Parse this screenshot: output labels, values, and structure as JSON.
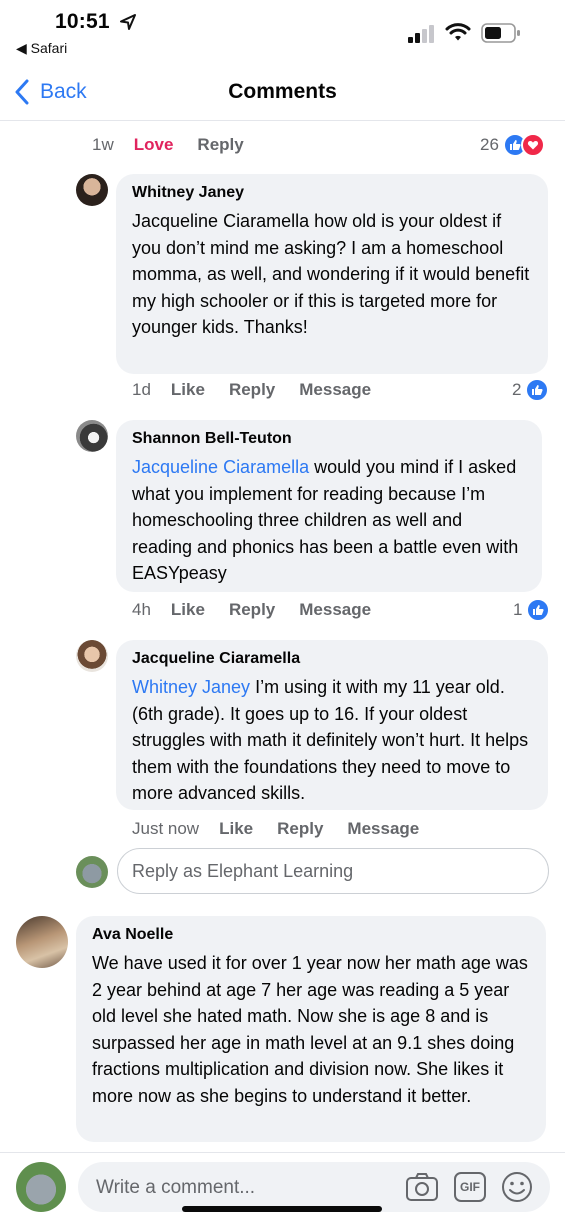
{
  "status_bar": {
    "time": "10:51",
    "back_app": "◀ Safari"
  },
  "nav": {
    "back_label": "Back",
    "title": "Comments"
  },
  "top_row": {
    "timestamp": "1w",
    "love_label": "Love",
    "reply_label": "Reply",
    "reaction_count": "26",
    "reactions": [
      "like-icon",
      "love-icon"
    ]
  },
  "comments": [
    {
      "author": "Whitney Janey",
      "text": "Jacqueline Ciaramella how old is your oldest if you don’t mind me asking? I am a homeschool momma, as well, and wondering if it would benefit my high schooler or if this is targeted more for younger kids. Thanks!",
      "timestamp": "1d",
      "actions": [
        "Like",
        "Reply",
        "Message"
      ],
      "reaction_count": "2"
    },
    {
      "author": "Shannon Bell-Teuton",
      "mention": "Jacqueline Ciaramella",
      "text": " would you mind if I asked what you implement for reading because I’m homeschooling three children as well and reading and phonics has been a battle even with EASYpeasy",
      "timestamp": "4h",
      "actions": [
        "Like",
        "Reply",
        "Message"
      ],
      "reaction_count": "1"
    },
    {
      "author": "Jacqueline Ciaramella",
      "mention": "Whitney Janey",
      "text": " I’m using it with my 11 year old. (6th grade). It goes up to 16. If your oldest struggles with math it definitely won’t hurt. It helps them with the foundations they need to move to more advanced skills.",
      "timestamp": "Just now",
      "actions": [
        "Like",
        "Reply",
        "Message"
      ]
    },
    {
      "author": "Ava Noelle",
      "text": "We have used it for over 1 year now her math age was 2 year behind at age 7 her age was reading a 5 year old level she hated math. Now she is age 8 and is surpassed her age in math level at an 9.1 shes doing fractions multiplication and division now. She likes it more now as she begins to understand it better."
    }
  ],
  "reply_box": {
    "placeholder": "Reply as Elephant Learning"
  },
  "composer": {
    "placeholder": "Write a comment...",
    "icons": [
      "camera-icon",
      "gif-icon",
      "emoji-icon"
    ],
    "gif_label": "GIF"
  },
  "colors": {
    "link_blue": "#2d79f3",
    "love_red": "#e0245e",
    "bubble_gray": "#f0f2f5",
    "meta_gray": "#65676b"
  }
}
